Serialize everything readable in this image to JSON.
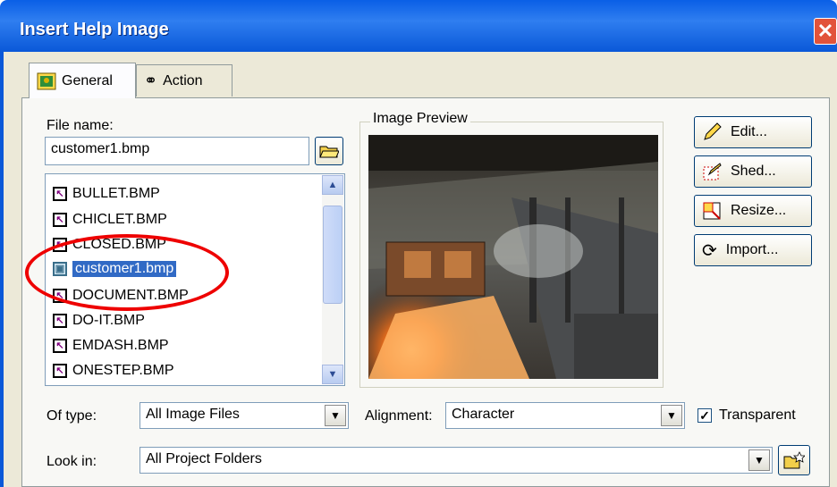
{
  "window": {
    "title": "Insert Help Image",
    "close_glyph": "✕"
  },
  "tabs": [
    {
      "label": "General",
      "icon": "image-icon",
      "active": true
    },
    {
      "label": "Action",
      "icon": "link-icon",
      "active": false
    }
  ],
  "file_name": {
    "label": "File name:",
    "value": "customer1.bmp"
  },
  "file_list": {
    "items": [
      {
        "name": "BULLET.BMP",
        "selected": false
      },
      {
        "name": "CHICLET.BMP",
        "selected": false
      },
      {
        "name": "CLOSED.BMP",
        "selected": false
      },
      {
        "name": "customer1.bmp",
        "selected": true
      },
      {
        "name": "DOCUMENT.BMP",
        "selected": false
      },
      {
        "name": "DO-IT.BMP",
        "selected": false
      },
      {
        "name": "EMDASH.BMP",
        "selected": false
      },
      {
        "name": "ONESTEP.BMP",
        "selected": false
      }
    ]
  },
  "preview": {
    "label": "Image Preview"
  },
  "buttons": {
    "edit": "Edit...",
    "shed": "Shed...",
    "resize": "Resize...",
    "import": "Import..."
  },
  "of_type": {
    "label": "Of type:",
    "value": "All Image Files"
  },
  "alignment": {
    "label": "Alignment:",
    "value": "Character"
  },
  "transparent": {
    "label": "Transparent",
    "checked": true
  },
  "look_in": {
    "label": "Look in:",
    "value": "All Project Folders"
  },
  "colors": {
    "title_bar": "#0a5fe6",
    "selection": "#316ac5",
    "highlight_ellipse": "#e00000",
    "dialog_bg": "#ece9d8"
  }
}
